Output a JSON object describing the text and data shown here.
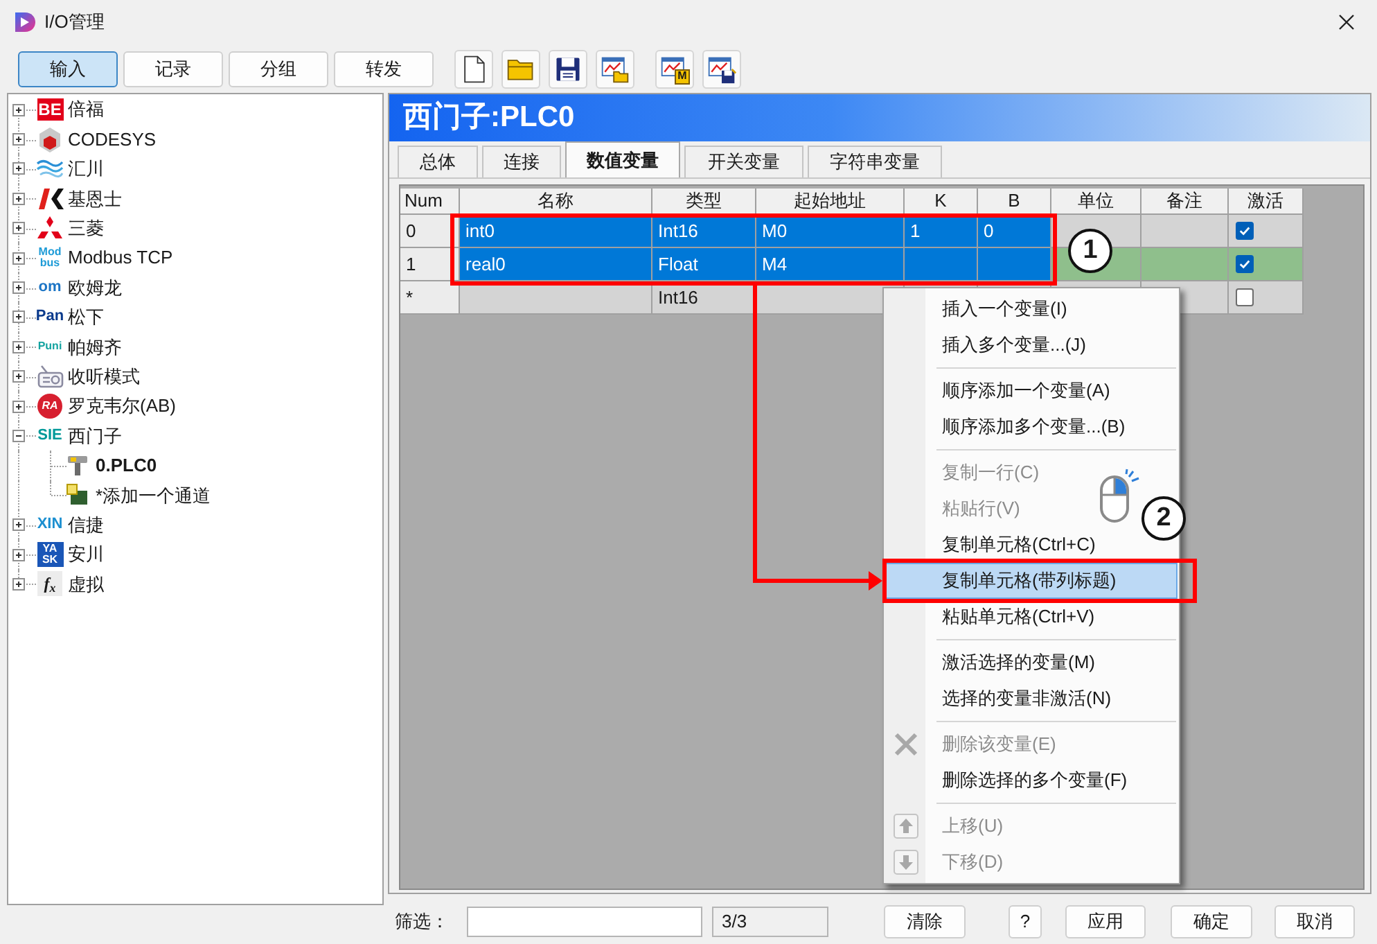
{
  "window": {
    "title": "I/O管理"
  },
  "toolbar": {
    "tabs": [
      {
        "label": "输入",
        "selected": true
      },
      {
        "label": "记录",
        "selected": false
      },
      {
        "label": "分组",
        "selected": false
      },
      {
        "label": "转发",
        "selected": false
      }
    ],
    "tools": [
      {
        "kind": "new"
      },
      {
        "kind": "open"
      },
      {
        "kind": "save"
      },
      {
        "kind": "chart_open"
      },
      {
        "kind": "chart_marker",
        "badge": "M"
      },
      {
        "kind": "chart_save"
      }
    ]
  },
  "tree": {
    "items": [
      {
        "label": "倍福",
        "expanded": false,
        "logo": {
          "kind": "tile",
          "lines": [
            "BE"
          ],
          "color": "#e2001a"
        }
      },
      {
        "label": "CODESYS",
        "expanded": false,
        "logo": {
          "kind": "cube"
        }
      },
      {
        "label": "汇川",
        "expanded": false,
        "logo": {
          "kind": "waves"
        }
      },
      {
        "label": "基恩士",
        "expanded": false,
        "logo": {
          "kind": "chevron"
        }
      },
      {
        "label": "三菱",
        "expanded": false,
        "logo": {
          "kind": "diamonds"
        }
      },
      {
        "label": "Modbus TCP",
        "expanded": false,
        "logo": {
          "kind": "stack",
          "lines": [
            "Mod",
            "bus"
          ],
          "color": "#1d9bd7"
        }
      },
      {
        "label": "欧姆龙",
        "expanded": false,
        "logo": {
          "kind": "word",
          "text": "om",
          "color": "#1b74c5"
        }
      },
      {
        "label": "松下",
        "expanded": false,
        "logo": {
          "kind": "word",
          "text": "Pan",
          "color": "#0a3a8c"
        }
      },
      {
        "label": "帕姆齐",
        "expanded": false,
        "logo": {
          "kind": "small",
          "text": "Puni",
          "color": "#13a3a0"
        }
      },
      {
        "label": "收听模式",
        "expanded": false,
        "logo": {
          "kind": "radio"
        }
      },
      {
        "label": "罗克韦尔(AB)",
        "expanded": false,
        "logo": {
          "kind": "disc",
          "text": "RA",
          "color": "#d71f2f"
        }
      },
      {
        "label": "西门子",
        "expanded": true,
        "logo": {
          "kind": "word",
          "text": "SIE",
          "color": "#009999"
        },
        "children": [
          {
            "label": "0.PLC0",
            "kind": "plc",
            "active": true
          },
          {
            "label": "*添加一个通道",
            "kind": "add",
            "active": false
          }
        ]
      },
      {
        "label": "信捷",
        "expanded": false,
        "logo": {
          "kind": "word",
          "text": "XIN",
          "color": "#1c8fd0"
        }
      },
      {
        "label": "安川",
        "expanded": false,
        "logo": {
          "kind": "tile",
          "lines": [
            "YA",
            "SK"
          ],
          "color": "#1a56b7"
        }
      },
      {
        "label": "虚拟",
        "expanded": false,
        "logo": {
          "kind": "formula",
          "text": "f$_{x}$"
        }
      }
    ]
  },
  "panel": {
    "title": "西门子:PLC0",
    "tabs": [
      {
        "label": "总体",
        "selected": false
      },
      {
        "label": "连接",
        "selected": false
      },
      {
        "label": "数值变量",
        "selected": true
      },
      {
        "label": "开关变量",
        "selected": false
      },
      {
        "label": "字符串变量",
        "selected": false
      }
    ],
    "table": {
      "columns": [
        "Num",
        "名称",
        "类型",
        "起始地址",
        "K",
        "B",
        "单位",
        "备注",
        "激活"
      ],
      "rows": [
        {
          "num": "0",
          "name": "int0",
          "type": "Int16",
          "address": "M0",
          "k": "1",
          "b": "0",
          "selected": true,
          "checked": true,
          "color": "#d4d4d4"
        },
        {
          "num": "1",
          "name": "real0",
          "type": "Float",
          "address": "M4",
          "selected": true,
          "checked": true,
          "color": "#8fbf8c"
        },
        {
          "num": "*",
          "type": "Int16",
          "selected": false,
          "checked": false,
          "color": "#d4d4d4"
        }
      ]
    }
  },
  "context_menu": {
    "items": [
      {
        "kind": "item",
        "label": "插入一个变量(I)",
        "disabled": false,
        "selected": false
      },
      {
        "kind": "item",
        "label": "插入多个变量...(J)",
        "disabled": false,
        "selected": false
      },
      {
        "kind": "separator"
      },
      {
        "kind": "item",
        "label": "顺序添加一个变量(A)",
        "disabled": false,
        "selected": false
      },
      {
        "kind": "item",
        "label": "顺序添加多个变量...(B)",
        "disabled": false,
        "selected": false
      },
      {
        "kind": "separator"
      },
      {
        "kind": "item",
        "label": "复制一行(C)",
        "disabled": true,
        "selected": false
      },
      {
        "kind": "item",
        "label": "粘贴行(V)",
        "disabled": true,
        "selected": false
      },
      {
        "kind": "item",
        "label": "复制单元格(Ctrl+C)",
        "disabled": false,
        "selected": false
      },
      {
        "kind": "item",
        "label": "复制单元格(带列标题)",
        "disabled": false,
        "selected": true
      },
      {
        "kind": "item",
        "label": "粘贴单元格(Ctrl+V)",
        "disabled": false,
        "selected": false
      },
      {
        "kind": "separator"
      },
      {
        "kind": "item",
        "label": "激活选择的变量(M)",
        "disabled": false,
        "selected": false
      },
      {
        "kind": "item",
        "label": "选择的变量非激活(N)",
        "disabled": false,
        "selected": false
      },
      {
        "kind": "separator"
      },
      {
        "kind": "delete",
        "label": "删除该变量(E)",
        "disabled": true,
        "selected": false
      },
      {
        "kind": "item",
        "label": "删除选择的多个变量(F)",
        "disabled": false,
        "selected": false
      },
      {
        "kind": "separator"
      },
      {
        "kind": "up",
        "label": "上移(U)",
        "disabled": true,
        "selected": false
      },
      {
        "kind": "down",
        "label": "下移(D)",
        "disabled": true,
        "selected": false
      }
    ]
  },
  "annotations": [
    {
      "label": "1"
    },
    {
      "label": "2"
    }
  ],
  "bottom_bar": {
    "filter_label": "筛选：",
    "count": "3/3",
    "buttons": [
      {
        "label": "清除"
      },
      {
        "label": "?"
      },
      {
        "label": "应用"
      },
      {
        "label": "确定"
      },
      {
        "label": "取消"
      }
    ]
  }
}
